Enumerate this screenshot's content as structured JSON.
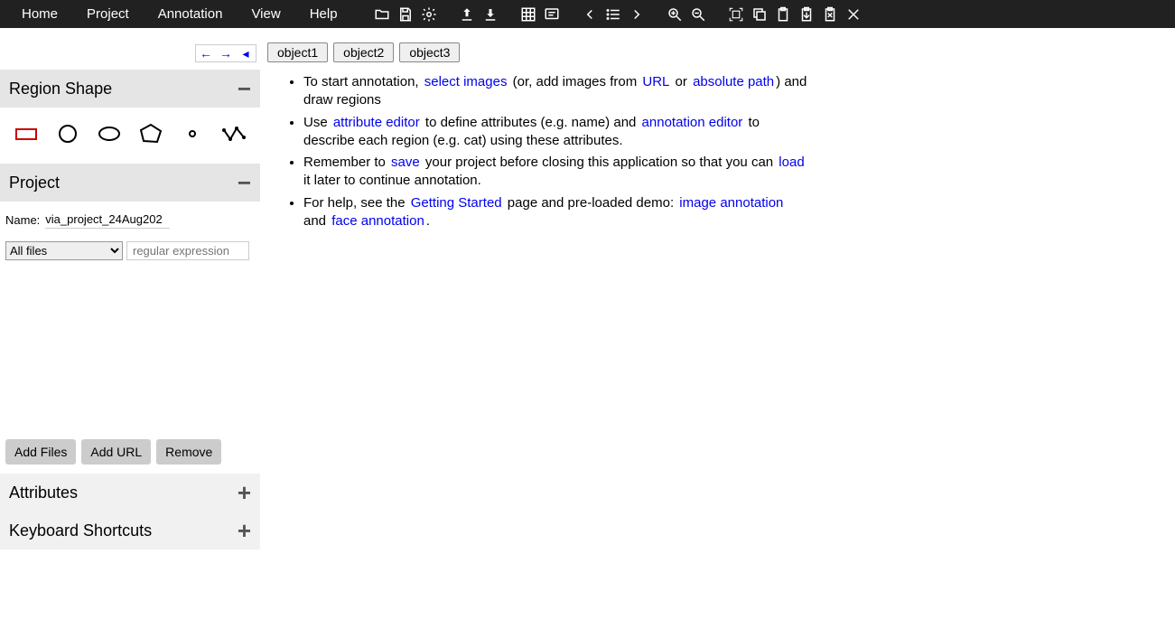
{
  "menubar": {
    "items": [
      "Home",
      "Project",
      "Annotation",
      "View",
      "Help"
    ]
  },
  "sidebar": {
    "region_shape": {
      "title": "Region Shape",
      "toggle": "−"
    },
    "project": {
      "title": "Project",
      "toggle": "−",
      "name_label": "Name:",
      "name_value": "via_project_24Aug202",
      "filter_select": "All files",
      "filter_placeholder": "regular expression",
      "buttons": {
        "add_files": "Add Files",
        "add_url": "Add URL",
        "remove": "Remove"
      }
    },
    "attributes": {
      "title": "Attributes",
      "toggle": "+"
    },
    "shortcuts": {
      "title": "Keyboard Shortcuts",
      "toggle": "+"
    }
  },
  "content": {
    "objects": [
      "object1",
      "object2",
      "object3"
    ],
    "instr": {
      "li1_a": "To start annotation, ",
      "li1_link1": "select images",
      "li1_b": " (or, add images from ",
      "li1_link2": "URL",
      "li1_c": " or ",
      "li1_link3": "absolute path",
      "li1_d": ") and draw regions",
      "li2_a": "Use ",
      "li2_link1": "attribute editor",
      "li2_b": " to define attributes (e.g. name) and ",
      "li2_link2": "annotation editor",
      "li2_c": " to describe each region (e.g. cat) using these attributes.",
      "li3_a": "Remember to ",
      "li3_link1": "save",
      "li3_b": " your project before closing this application so that you can ",
      "li3_link2": "load",
      "li3_c": " it later to continue annotation.",
      "li4_a": "For help, see the ",
      "li4_link1": "Getting Started",
      "li4_b": " page and pre-loaded demo: ",
      "li4_link2": "image annotation",
      "li4_c": " and ",
      "li4_link3": "face annotation",
      "li4_d": "."
    }
  }
}
